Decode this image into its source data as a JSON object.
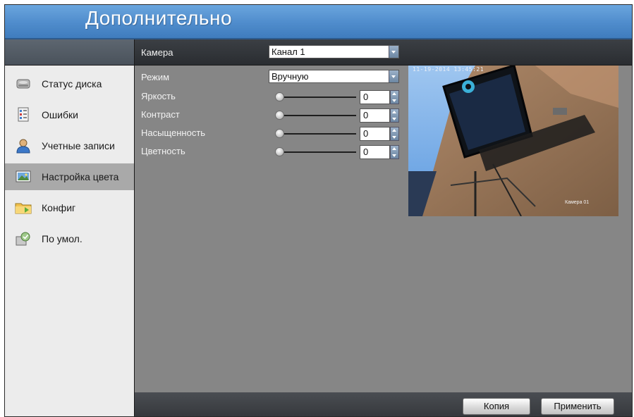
{
  "window": {
    "title": "Дополнительно"
  },
  "sidebar": {
    "items": [
      {
        "label": "Статус диска",
        "icon": "disk-icon",
        "active": false
      },
      {
        "label": "Ошибки",
        "icon": "error-log-icon",
        "active": false
      },
      {
        "label": "Учетные записи",
        "icon": "user-icon",
        "active": false
      },
      {
        "label": "Настройка цвета",
        "icon": "image-color-icon",
        "active": true
      },
      {
        "label": "Конфиг",
        "icon": "folder-config-icon",
        "active": false
      },
      {
        "label": "По умол.",
        "icon": "defaults-icon",
        "active": false
      }
    ]
  },
  "form": {
    "camera": {
      "label": "Камера",
      "value": "Канал 1"
    },
    "mode": {
      "label": "Режим",
      "value": "Вручную"
    },
    "sliders": [
      {
        "label": "Яркость",
        "value": "0"
      },
      {
        "label": "Контраст",
        "value": "0"
      },
      {
        "label": "Насыщенность",
        "value": "0"
      },
      {
        "label": "Цветность",
        "value": "0"
      }
    ]
  },
  "preview": {
    "timestamp": "11-19-2014 13:45:21",
    "camera_label": "Камера 01"
  },
  "footer": {
    "copy_label": "Копия",
    "apply_label": "Применить"
  },
  "colors": {
    "title_bar": "#4f8ccc",
    "panel": "#868686",
    "sidebar": "#ececec",
    "sidebar_active": "#a9a9a9",
    "footer": "#3b3e42"
  }
}
